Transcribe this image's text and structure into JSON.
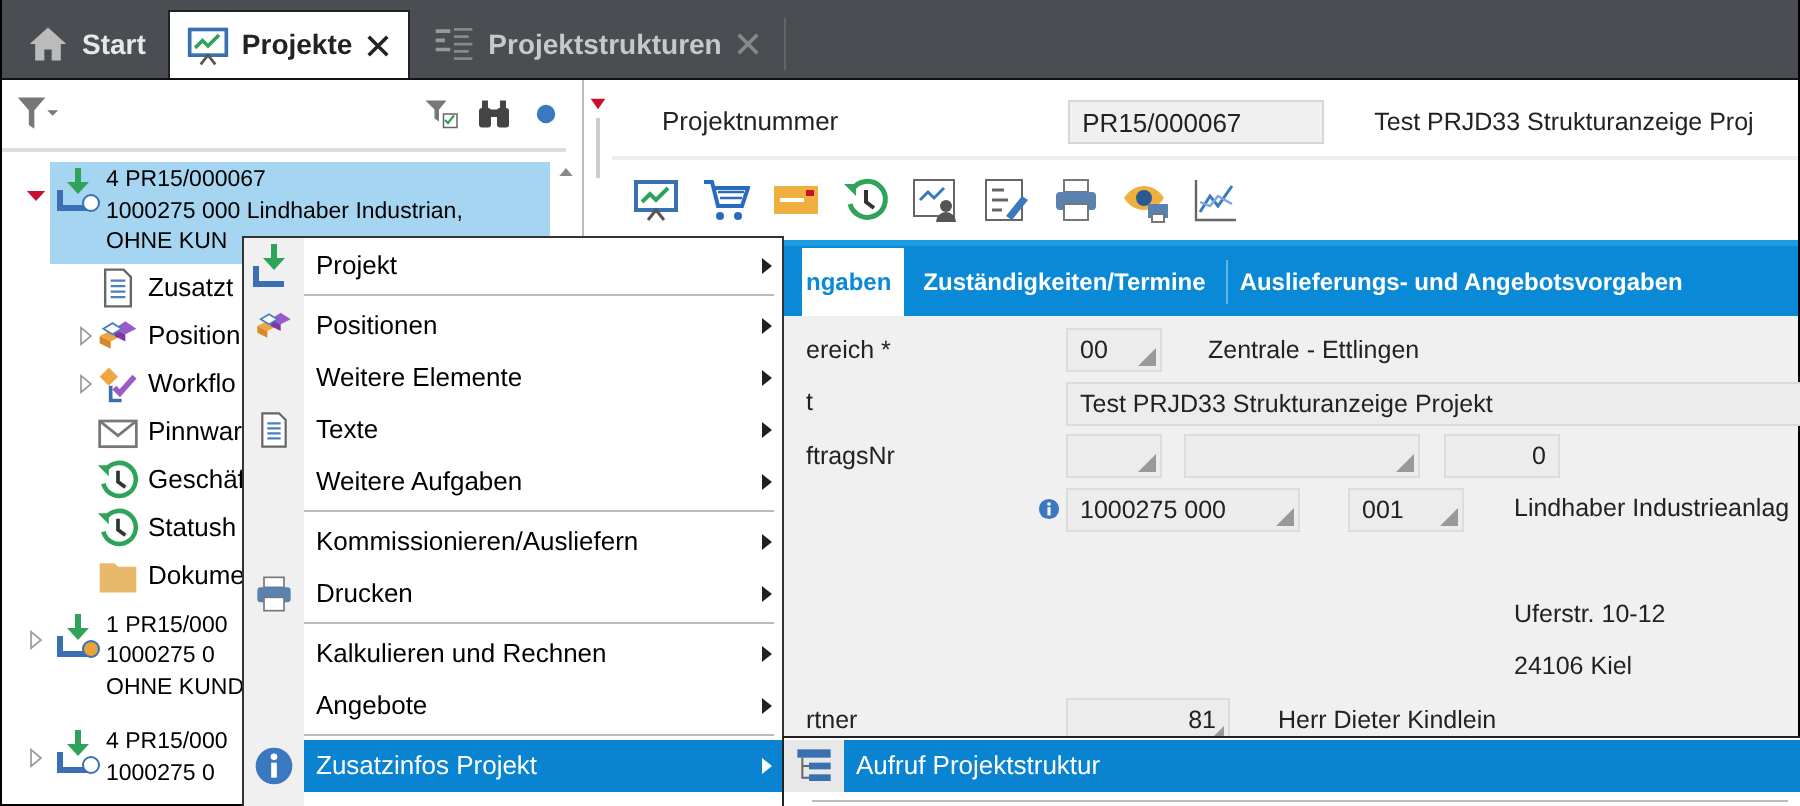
{
  "top_tabs": [
    {
      "label": "Start",
      "kind": "home",
      "selected": false,
      "closable": false
    },
    {
      "label": "Projekte",
      "kind": "chart",
      "selected": true,
      "closable": true
    },
    {
      "label": "Projektstrukturen",
      "kind": "structure",
      "selected": false,
      "closable": true
    }
  ],
  "tree": [
    {
      "lines": [
        "4 PR15/000067",
        "1000275 000 Lindhaber Industrian,",
        "OHNE KUN"
      ],
      "kind": "project",
      "color": "#ffffff",
      "expanded": true,
      "selected": true,
      "children": [
        {
          "label": "Zusatzt",
          "kind": "document",
          "selected": false
        },
        {
          "label": "Position",
          "kind": "positions",
          "expanded": false,
          "selected": false
        },
        {
          "label": "Workflo",
          "kind": "workflow",
          "expanded": false,
          "selected": false
        },
        {
          "label": "Pinnwar",
          "kind": "mail",
          "selected": false
        },
        {
          "label": "Geschäf",
          "kind": "history",
          "selected": false
        },
        {
          "label": "Statush",
          "kind": "history",
          "selected": false
        },
        {
          "label": "Dokume",
          "kind": "folder",
          "selected": false
        }
      ]
    },
    {
      "lines": [
        "1 PR15/000",
        "1000275 0",
        "OHNE KUND"
      ],
      "kind": "project",
      "color": "#e8a33d",
      "expanded": false,
      "selected": false
    },
    {
      "lines": [
        "4 PR15/000",
        "1000275 0"
      ],
      "kind": "project",
      "color": "#ffffff",
      "expanded": false,
      "selected": false
    }
  ],
  "header": {
    "label": "Projektnummer",
    "number": "PR15/000067",
    "title": "Test PRJD33 Strukturanzeige Proj"
  },
  "detail_tabs": [
    {
      "label": "ngaben",
      "selected": true
    },
    {
      "label": "Zuständigkeiten/Termine",
      "selected": false
    },
    {
      "label": "Auslieferungs- und Angebotsvorgaben",
      "selected": false
    }
  ],
  "form_rows": [
    {
      "label": "ereich *",
      "fields": [
        {
          "kind": "dropdown",
          "value": "00"
        },
        {
          "kind": "text",
          "value": "Zentrale - Ettlingen"
        }
      ]
    },
    {
      "label": "t",
      "fields": [
        {
          "kind": "input",
          "value": "Test PRJD33 Strukturanzeige Projekt"
        }
      ]
    },
    {
      "label": "ftragsNr",
      "fields": [
        {
          "kind": "dropdown"
        },
        {
          "kind": "dropdown"
        },
        {
          "kind": "number",
          "value": "0"
        }
      ]
    },
    {
      "info": true,
      "fields": [
        {
          "kind": "dropdown",
          "value": "1000275 000"
        },
        {
          "kind": "dropdown",
          "value": "001"
        },
        {
          "kind": "text",
          "value": "Lindhaber Industrieanlag"
        }
      ]
    },
    {
      "fields": [
        {
          "kind": "text",
          "value": "Uferstr. 10-12"
        }
      ]
    },
    {
      "fields": [
        {
          "kind": "text",
          "value": "24106 Kiel"
        }
      ]
    },
    {
      "label": "rtner",
      "fields": [
        {
          "kind": "number_dropdown",
          "value": "81"
        },
        {
          "kind": "text",
          "value": "Herr Dieter Kindlein"
        }
      ]
    }
  ],
  "context_menu": {
    "groups": [
      [
        {
          "label": "Projekt",
          "kind": "project",
          "selected": false
        }
      ],
      [
        {
          "label": "Positionen",
          "kind": "positions",
          "selected": false
        },
        {
          "label": "Weitere Elemente",
          "kind": "plain",
          "selected": false
        },
        {
          "label": "Texte",
          "kind": "document",
          "selected": false
        },
        {
          "label": "Weitere Aufgaben",
          "kind": "plain",
          "selected": false
        }
      ],
      [
        {
          "label": "Kommissionieren/Ausliefern",
          "kind": "plain",
          "selected": false
        },
        {
          "label": "Drucken",
          "kind": "printer",
          "selected": false
        }
      ],
      [
        {
          "label": "Kalkulieren und Rechnen",
          "kind": "plain",
          "selected": false
        },
        {
          "label": "Angebote",
          "kind": "plain",
          "selected": false
        }
      ],
      [
        {
          "label": "Zusatzinfos Projekt",
          "kind": "info",
          "selected": true
        }
      ]
    ]
  },
  "submenu": {
    "items": [
      {
        "label": "Aufruf Projektstruktur",
        "selected": true
      }
    ]
  }
}
